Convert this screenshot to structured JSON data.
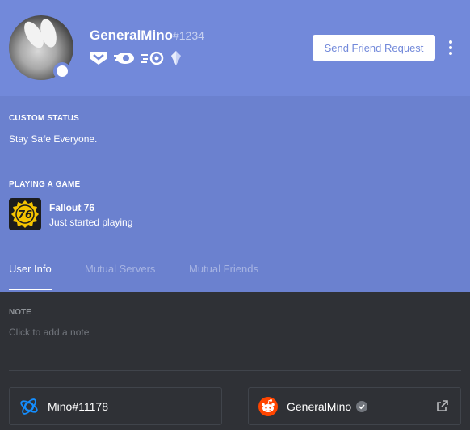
{
  "profile": {
    "username": "GeneralMino",
    "discriminator": "#1234",
    "status": "online",
    "badges": [
      "hypesquad-bravery-icon",
      "nitro-classic-icon",
      "server-booster-icon",
      "early-supporter-icon"
    ]
  },
  "actions": {
    "send_friend_request": "Send Friend Request",
    "more_icon": "kebab-menu-icon"
  },
  "activity": {
    "custom_status_title": "CUSTOM STATUS",
    "custom_status_text": "Stay Safe Everyone.",
    "playing_title": "PLAYING A GAME",
    "game_name": "Fallout 76",
    "game_state": "Just started playing",
    "game_icon_text": "76"
  },
  "tabs": [
    {
      "label": "User Info",
      "active": true
    },
    {
      "label": "Mutual Servers",
      "active": false
    },
    {
      "label": "Mutual Friends",
      "active": false
    }
  ],
  "note": {
    "title": "NOTE",
    "placeholder": "Click to add a note"
  },
  "connections": [
    {
      "service": "battlenet",
      "icon": "battlenet-icon",
      "name": "Mino#11178",
      "verified": false
    },
    {
      "service": "reddit",
      "icon": "reddit-icon",
      "name": "GeneralMino",
      "verified": true,
      "external_link_icon": "external-link-icon"
    }
  ],
  "colors": {
    "blurple": "#7289da",
    "activity_bg": "#6b81cf",
    "dark_bg": "#2f3136",
    "reddit_orange": "#ff4500"
  }
}
